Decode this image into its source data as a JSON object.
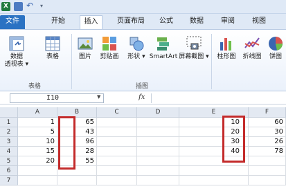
{
  "titlebar": {
    "logo": "X",
    "icons": [
      "excel-logo",
      "save-icon",
      "undo-icon",
      "separator"
    ]
  },
  "tabs": [
    {
      "label": "文件"
    },
    {
      "label": "开始"
    },
    {
      "label": "插入"
    },
    {
      "label": "页面布局"
    },
    {
      "label": "公式"
    },
    {
      "label": "数据"
    },
    {
      "label": "审阅"
    },
    {
      "label": "视图"
    }
  ],
  "ribbon": {
    "tables_group": {
      "label": "表格",
      "pivot_line1": "数据",
      "pivot_line2": "透视表",
      "table": "表格"
    },
    "illustrations_group": {
      "label": "插图",
      "picture": "图片",
      "clipart": "剪贴画",
      "shapes": "形状",
      "smartart": "SmartArt",
      "screenshot": "屏幕截图"
    },
    "charts_group": {
      "column": "柱形图",
      "line": "折线图",
      "pie": "饼图"
    }
  },
  "formula_bar": {
    "name_box": "I10",
    "fx": "fx",
    "value": ""
  },
  "grid": {
    "columns": [
      "A",
      "B",
      "C",
      "D",
      "E",
      "F"
    ],
    "rows": [
      "1",
      "2",
      "3",
      "4",
      "5",
      "6",
      "7"
    ],
    "colA": [
      "1",
      "5",
      "10",
      "15",
      "20"
    ],
    "colB": [
      "65",
      "43",
      "96",
      "28",
      "55"
    ],
    "colE": [
      "10",
      "20",
      "30",
      "40"
    ],
    "colF": [
      "60",
      "30",
      "26",
      "78"
    ]
  },
  "colors": {
    "highlight": "#c32a2a",
    "file_tab": "#2a72c3",
    "ribbon_bg": "#dfe9f6"
  }
}
